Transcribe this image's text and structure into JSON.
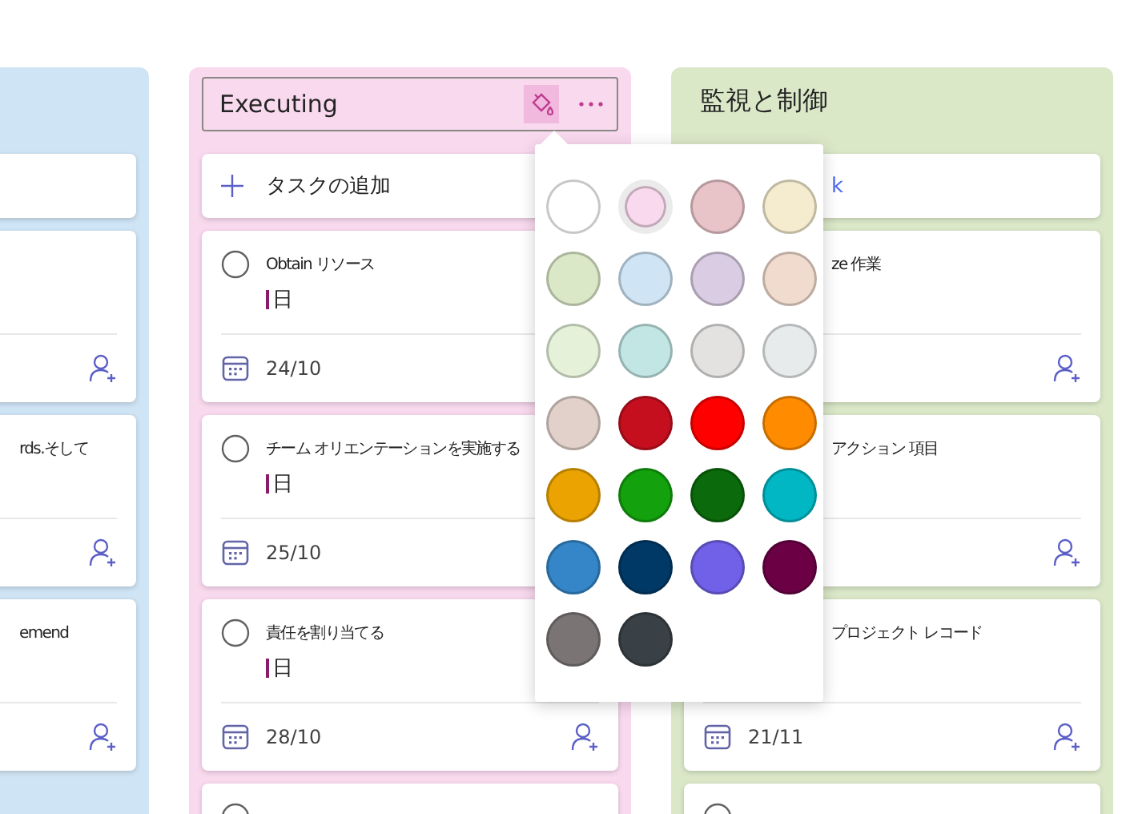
{
  "columns": [
    {
      "kind": "partial",
      "color": "#cfe4f5",
      "tasks": [
        {
          "assign_icon": true
        },
        {
          "title": "rds.そして",
          "assign_icon": true
        },
        {
          "title": "emend",
          "assign_icon": true
        }
      ]
    },
    {
      "kind": "full",
      "color": "#f9d9ee",
      "header": {
        "title": "Executing",
        "editing": true
      },
      "add_task": "タスクの追加",
      "tasks": [
        {
          "checked": false,
          "title": "Obtain リソース",
          "duration": "日",
          "date": "24/10",
          "assign_icon": false
        },
        {
          "checked": false,
          "title": "チーム オリエンテーションを実施する",
          "duration": "日",
          "date": "25/10",
          "assign_icon": false
        },
        {
          "checked": false,
          "title": "責任を割り当てる",
          "duration": "日",
          "date": "28/10",
          "assign_icon": true
        },
        {
          "checked": false
        }
      ]
    },
    {
      "kind": "covered",
      "color": "#dbe8c8",
      "header": {
        "title": "監視と制御",
        "editing": false
      },
      "add_task": "k",
      "tasks": [
        {
          "title": "ze 作業",
          "assign_icon": true
        },
        {
          "title": "アクション 項目",
          "assign_icon": true
        },
        {
          "title": "プロジェクト レコード",
          "date": "21/11",
          "assign_icon": true
        },
        {
          "checked": false
        }
      ]
    }
  ],
  "popup": {
    "swatches": [
      {
        "color": "#ffffff",
        "selected": false
      },
      {
        "color": "#f9d9ee",
        "selected": true
      },
      {
        "color": "#e8c4c9",
        "selected": false
      },
      {
        "color": "#f5ecd0",
        "selected": false
      },
      {
        "color": "#dbe8c8",
        "selected": false
      },
      {
        "color": "#cfe4f5",
        "selected": false
      },
      {
        "color": "#d9cce3",
        "selected": false
      },
      {
        "color": "#f1dbcf",
        "selected": false
      },
      {
        "color": "#e5f2d9",
        "selected": false
      },
      {
        "color": "#c1e6e4",
        "selected": false
      },
      {
        "color": "#e3e2e1",
        "selected": false
      },
      {
        "color": "#e8ebec",
        "selected": false
      },
      {
        "color": "#e2d1ca",
        "selected": false
      },
      {
        "color": "#c50f1f",
        "selected": false
      },
      {
        "color": "#ff0000",
        "selected": false
      },
      {
        "color": "#ff8c00",
        "selected": false
      },
      {
        "color": "#eaa300",
        "selected": false
      },
      {
        "color": "#13a10e",
        "selected": false
      },
      {
        "color": "#0b6a0b",
        "selected": false
      },
      {
        "color": "#00b7c3",
        "selected": false
      },
      {
        "color": "#3486c8",
        "selected": false
      },
      {
        "color": "#003966",
        "selected": false
      },
      {
        "color": "#7160e8",
        "selected": false
      },
      {
        "color": "#6b0045",
        "selected": false
      },
      {
        "color": "#7a7574",
        "selected": false
      },
      {
        "color": "#394146",
        "selected": false
      }
    ]
  }
}
